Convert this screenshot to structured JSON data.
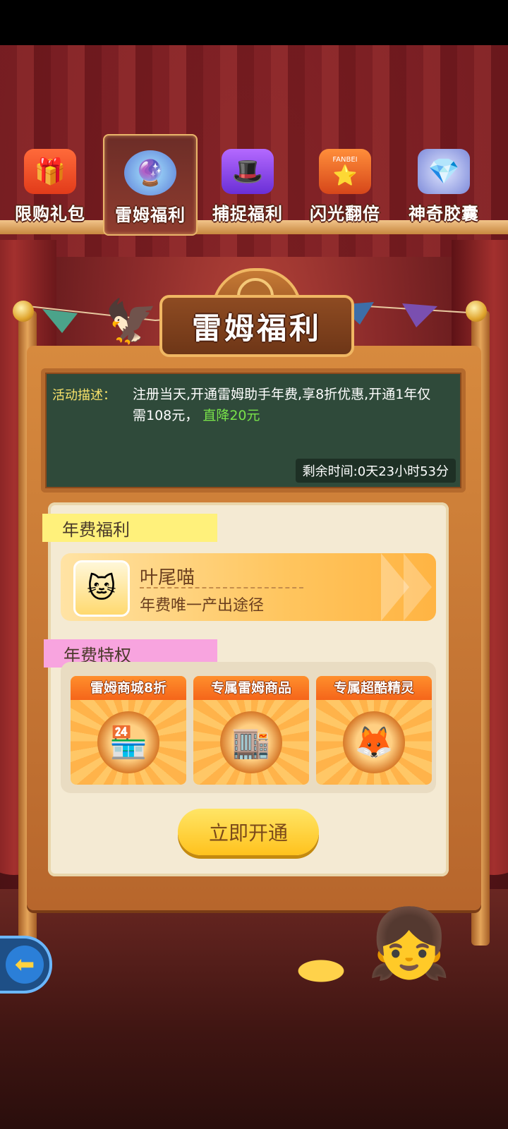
{
  "tabs": [
    {
      "label": "限购礼包",
      "icon": "gift-box-icon",
      "active": false
    },
    {
      "label": "雷姆福利",
      "icon": "crystal-ball-icon",
      "active": true
    },
    {
      "label": "捕捉福利",
      "icon": "capture-hat-icon",
      "active": false
    },
    {
      "label": "闪光翻倍",
      "icon": "fanbei-machine-icon",
      "active": false
    },
    {
      "label": "神奇胶囊",
      "icon": "capsule-icon",
      "active": false
    }
  ],
  "tab_machine_text": "FANBEI",
  "board": {
    "title": "雷姆福利"
  },
  "activity": {
    "label": "活动描述：",
    "text": "注册当天,开通雷姆助手年费,享8折优惠,开通1年仅需108元，",
    "highlight": "直降20元",
    "timer": "剩余时间:0天23小时53分"
  },
  "annual_benefit": {
    "section_title": "年费福利",
    "reward_name": "叶尾喵",
    "reward_desc": "年费唯一产出途径"
  },
  "annual_privilege": {
    "section_title": "年费特权",
    "perks": [
      {
        "title": "雷姆商城8折",
        "icon": "discount-shop-icon"
      },
      {
        "title": "专属雷姆商品",
        "icon": "assistant-shop-icon"
      },
      {
        "title": "专属超酷精灵",
        "icon": "exclusive-pet-icon"
      }
    ]
  },
  "cta_label": "立即开通",
  "colors": {
    "accent_yellow": "#ffc21d",
    "highlight_green": "#79e34a",
    "chalk_label": "#f8e26a",
    "chalkboard": "#2f4a3a"
  }
}
